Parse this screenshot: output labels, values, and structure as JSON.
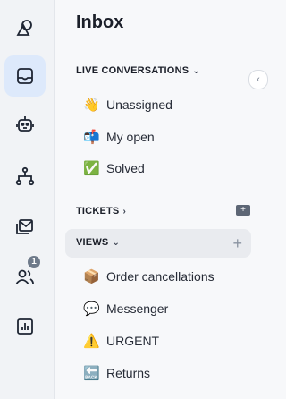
{
  "rail": {
    "items": [
      {
        "icon": "shapes-icon"
      },
      {
        "icon": "inbox-icon",
        "active": true
      },
      {
        "icon": "bot-icon"
      },
      {
        "icon": "org-tree-icon"
      },
      {
        "icon": "mail-icon"
      },
      {
        "icon": "users-icon",
        "badge": "1"
      },
      {
        "icon": "bar-chart-icon"
      }
    ]
  },
  "panel": {
    "title": "Inbox",
    "live": {
      "label": "LIVE CONVERSATIONS",
      "items": [
        {
          "emoji": "👋",
          "label": "Unassigned"
        },
        {
          "emoji": "📬",
          "label": "My open"
        },
        {
          "emoji": "✅",
          "label": "Solved"
        }
      ]
    },
    "tickets": {
      "label": "TICKETS"
    },
    "views": {
      "label": "VIEWS",
      "add": "+",
      "items": [
        {
          "emoji": "📦",
          "label": "Order cancellations"
        },
        {
          "emoji": "💬",
          "label": "Messenger"
        },
        {
          "emoji": "⚠️",
          "label": "URGENT"
        },
        {
          "emoji": "🔙",
          "label": "Returns"
        }
      ]
    }
  }
}
